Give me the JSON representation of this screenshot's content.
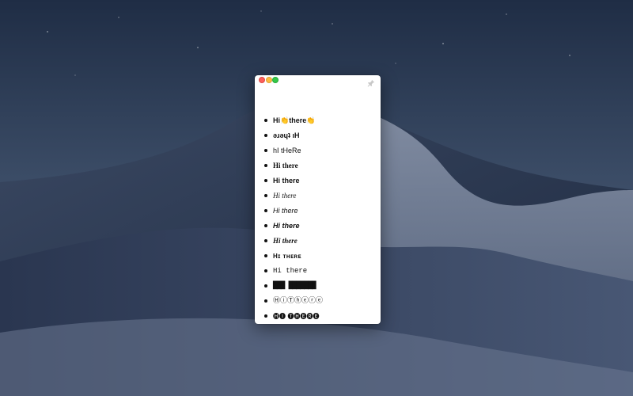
{
  "window": {
    "buttons": [
      "close",
      "minimize",
      "zoom"
    ],
    "pin_icon": "pin-icon"
  },
  "styles": [
    {
      "style": "default",
      "text": "Hi👏there👏"
    },
    {
      "style": "flip",
      "text": "ǝɹǝɥʇ ıH"
    },
    {
      "style": "alt",
      "text": "hI tHeRe"
    },
    {
      "style": "serif-bold",
      "text": "Hi there"
    },
    {
      "style": "sans-bold",
      "text": "Hi there"
    },
    {
      "style": "serif-italic",
      "text": "Hi there"
    },
    {
      "style": "sans-italic",
      "text": "Hi there"
    },
    {
      "style": "sans-bold-italic",
      "text": "Hi there"
    },
    {
      "style": "serif-bold-italic",
      "text": "Hi there"
    },
    {
      "style": "smallcaps",
      "text": "Hɪ ᴛʜᴇʀᴇ"
    },
    {
      "style": "mono",
      "text": "Hi there"
    },
    {
      "style": "blocks",
      "text": "███ ███████"
    },
    {
      "style": "circled",
      "text": "ⒽⓘⓉⓗⓔⓡⓔ"
    },
    {
      "style": "negcircled",
      "text": "🅗🅘 🅣🅗🅔🅡🅔"
    }
  ]
}
